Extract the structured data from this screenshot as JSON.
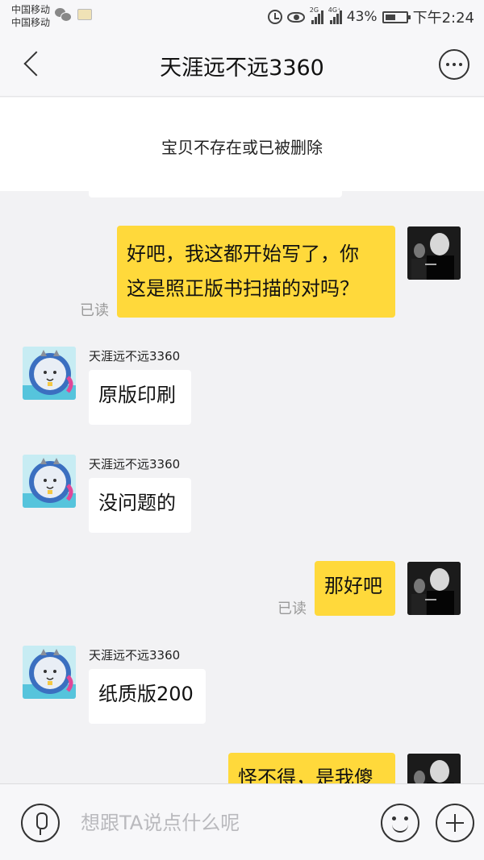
{
  "status_bar": {
    "carrier_1": "中国移动",
    "carrier_2": "中国移动",
    "net_tag_1": "2G",
    "net_tag_2": "4G⁺",
    "battery": "43%",
    "time": "下午2:24",
    "icons": [
      "wechat-icon",
      "book-icon",
      "alarm-icon",
      "eye-icon",
      "signal-icon",
      "battery-icon"
    ]
  },
  "header": {
    "title": "天涯远不远3360",
    "back_icon": "chevron-left-icon",
    "more_icon": "more-icon"
  },
  "notice": {
    "text": "宝贝不存在或已被删除"
  },
  "messages": [
    {
      "from": "me",
      "text": "好吧，我这都开始写了，你这是照正版书扫描的对吗？",
      "line1": "好吧，我这都开始写了，你",
      "line2": "这是照正版书扫描的对吗？",
      "status": "已读"
    },
    {
      "from": "them",
      "sender": "天涯远不远3360",
      "text": "原版印刷"
    },
    {
      "from": "them",
      "sender": "天涯远不远3360",
      "text": "没问题的"
    },
    {
      "from": "me",
      "text": "那好吧",
      "status": "已读"
    },
    {
      "from": "them",
      "sender": "天涯远不远3360",
      "text": "纸质版200"
    },
    {
      "from": "me",
      "text": "怪不得，是我傻"
    }
  ],
  "input_bar": {
    "placeholder": "想跟TA说点什么呢",
    "mic_icon": "microphone-icon",
    "emoji_icon": "emoji-icon",
    "plus_icon": "plus-icon"
  },
  "colors": {
    "my_bubble": "#ffd93b",
    "their_bubble": "#ffffff",
    "background": "#f2f2f4"
  }
}
